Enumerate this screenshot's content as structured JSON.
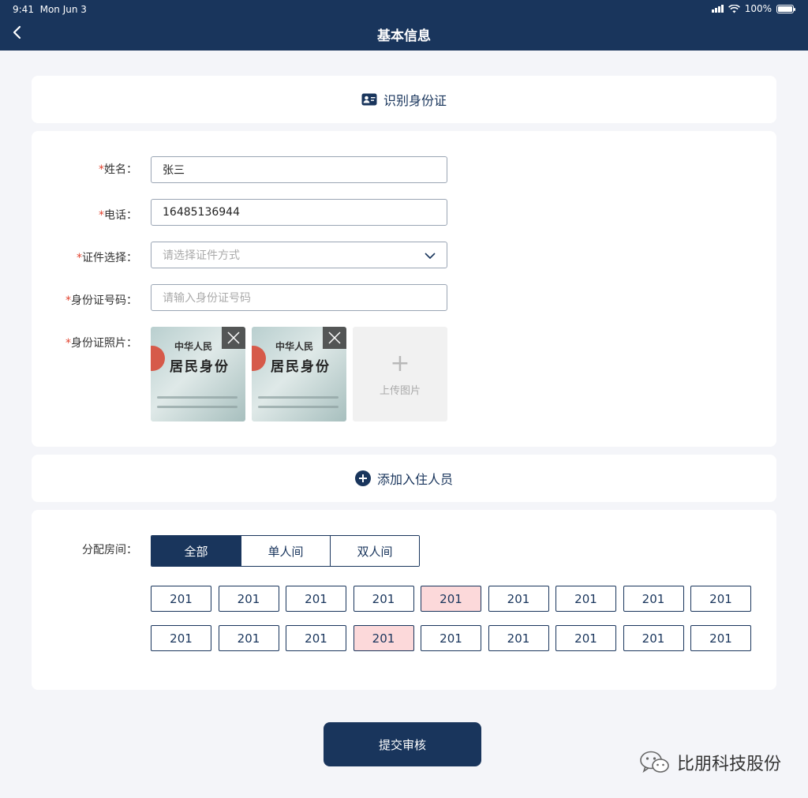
{
  "status_bar": {
    "time": "9:41",
    "date": "Mon Jun 3",
    "battery": "100%"
  },
  "nav": {
    "title": "基本信息",
    "back_icon": "chevron-left-icon"
  },
  "recognize": {
    "label": "识别身份证",
    "icon": "id-card-icon"
  },
  "form": {
    "name": {
      "label": "姓名：",
      "required": "*",
      "value": "张三"
    },
    "phone": {
      "label": "电话：",
      "required": "*",
      "value": "16485136944"
    },
    "id_type": {
      "label": "证件选择：",
      "required": "*",
      "placeholder": "请选择证件方式"
    },
    "id_number": {
      "label": "身份证号码：",
      "required": "*",
      "placeholder": "请输入身份证号码"
    },
    "id_photos": {
      "label": "身份证照片：",
      "required": "*",
      "photos": [
        {
          "line1": "中华人民",
          "line2": "居民身份"
        },
        {
          "line1": "中华人民",
          "line2": "居民身份"
        }
      ],
      "upload_label": "上传图片"
    }
  },
  "add_person": {
    "label": "添加入住人员",
    "icon": "plus-circle-icon"
  },
  "rooms": {
    "label": "分配房间：",
    "tabs": [
      {
        "label": "全部",
        "active": true
      },
      {
        "label": "单人间",
        "active": false
      },
      {
        "label": "双人间",
        "active": false
      }
    ],
    "items": [
      {
        "number": "201",
        "taken": false
      },
      {
        "number": "201",
        "taken": false
      },
      {
        "number": "201",
        "taken": false
      },
      {
        "number": "201",
        "taken": false
      },
      {
        "number": "201",
        "taken": true
      },
      {
        "number": "201",
        "taken": false
      },
      {
        "number": "201",
        "taken": false
      },
      {
        "number": "201",
        "taken": false
      },
      {
        "number": "201",
        "taken": false
      },
      {
        "number": "201",
        "taken": false
      },
      {
        "number": "201",
        "taken": false
      },
      {
        "number": "201",
        "taken": false
      },
      {
        "number": "201",
        "taken": true
      },
      {
        "number": "201",
        "taken": false
      },
      {
        "number": "201",
        "taken": false
      },
      {
        "number": "201",
        "taken": false
      },
      {
        "number": "201",
        "taken": false
      },
      {
        "number": "201",
        "taken": false
      }
    ]
  },
  "submit": {
    "label": "提交审核"
  },
  "watermark": {
    "text": "比朋科技股份"
  },
  "colors": {
    "primary": "#19355c",
    "taken": "#fcd9da",
    "required": "#e2432f",
    "background": "#f4f5f9"
  }
}
